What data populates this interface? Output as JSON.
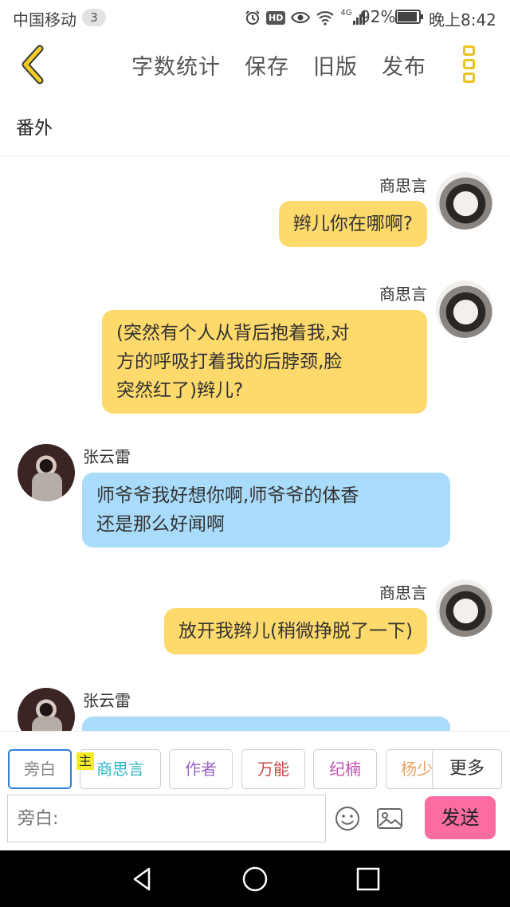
{
  "status_bar": {
    "carrier": "中国移动",
    "notification_count": "3",
    "network": "4G",
    "hd": "HD",
    "battery_text": "92%",
    "battery_level": 0.92,
    "time": "晚上8:42"
  },
  "toolbar": {
    "word_count": "字数统计",
    "save": "保存",
    "old_version": "旧版",
    "publish": "发布"
  },
  "chapter": {
    "title": "番外"
  },
  "messages": [
    {
      "side": "right",
      "sender": "商思言",
      "lines": [
        "辫儿你在哪啊?"
      ]
    },
    {
      "side": "right",
      "sender": "商思言",
      "lines": [
        "(突然有个人从背后抱着我,对",
        "方的呼吸打着我的后脖颈,脸",
        "突然红了)辫儿?"
      ]
    },
    {
      "side": "left",
      "sender": "张云雷",
      "lines": [
        "师爷爷我好想你啊,师爷爷的体香",
        "还是那么好闻啊"
      ]
    },
    {
      "side": "right",
      "sender": "商思言",
      "lines": [
        "放开我辫儿(稍微挣脱了一下)"
      ]
    },
    {
      "side": "left",
      "sender": "张云雷",
      "lines": [
        ""
      ]
    }
  ],
  "roles": [
    {
      "label": "旁白",
      "color": "#888888",
      "selected": true
    },
    {
      "label": "商思言",
      "color": "#2fb5c8",
      "main_tag": "主"
    },
    {
      "label": "作者",
      "color": "#9a63c7"
    },
    {
      "label": "万能",
      "color": "#d24545"
    },
    {
      "label": "纪楠",
      "color": "#c04fae"
    },
    {
      "label": "杨少",
      "color": "#e8a15f"
    }
  ],
  "more_roles": "更多",
  "input": {
    "placeholder": "旁白:"
  },
  "send": "发送",
  "colors": {
    "accent_yellow": "#e9c31c",
    "bubble_yellow": "#fed96b",
    "bubble_blue": "#a9dbfa",
    "send_pink": "#fb6da2"
  }
}
